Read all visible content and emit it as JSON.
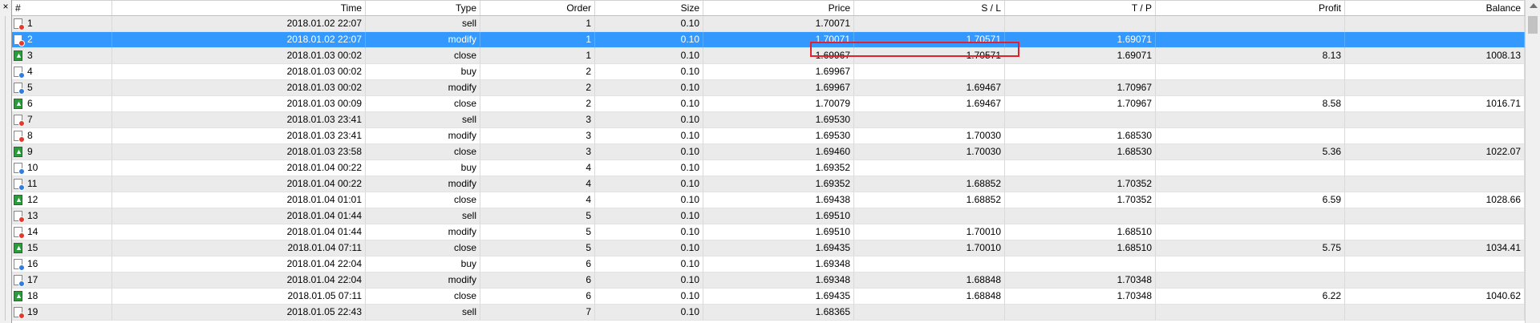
{
  "panel": {
    "close_label": "×"
  },
  "columns": [
    "#",
    "Time",
    "Type",
    "Order",
    "Size",
    "Price",
    "S / L",
    "T / P",
    "Profit",
    "Balance"
  ],
  "rows": [
    {
      "num": "1",
      "time": "2018.01.02 22:07",
      "type": "sell",
      "order": "1",
      "size": "0.10",
      "price": "1.70071",
      "sl": "",
      "tp": "",
      "profit": "",
      "balance": "",
      "icon": "sell"
    },
    {
      "num": "2",
      "time": "2018.01.02 22:07",
      "type": "modify",
      "order": "1",
      "size": "0.10",
      "price": "1.70071",
      "sl": "1.70571",
      "tp": "1.69071",
      "profit": "",
      "balance": "",
      "icon": "modify",
      "selected": true
    },
    {
      "num": "3",
      "time": "2018.01.03 00:02",
      "type": "close",
      "order": "1",
      "size": "0.10",
      "price": "1.69967",
      "sl": "1.70571",
      "tp": "1.69071",
      "profit": "8.13",
      "balance": "1008.13",
      "icon": "close"
    },
    {
      "num": "4",
      "time": "2018.01.03 00:02",
      "type": "buy",
      "order": "2",
      "size": "0.10",
      "price": "1.69967",
      "sl": "",
      "tp": "",
      "profit": "",
      "balance": "",
      "icon": "buy"
    },
    {
      "num": "5",
      "time": "2018.01.03 00:02",
      "type": "modify",
      "order": "2",
      "size": "0.10",
      "price": "1.69967",
      "sl": "1.69467",
      "tp": "1.70967",
      "profit": "",
      "balance": "",
      "icon": "buy"
    },
    {
      "num": "6",
      "time": "2018.01.03 00:09",
      "type": "close",
      "order": "2",
      "size": "0.10",
      "price": "1.70079",
      "sl": "1.69467",
      "tp": "1.70967",
      "profit": "8.58",
      "balance": "1016.71",
      "icon": "close"
    },
    {
      "num": "7",
      "time": "2018.01.03 23:41",
      "type": "sell",
      "order": "3",
      "size": "0.10",
      "price": "1.69530",
      "sl": "",
      "tp": "",
      "profit": "",
      "balance": "",
      "icon": "sell"
    },
    {
      "num": "8",
      "time": "2018.01.03 23:41",
      "type": "modify",
      "order": "3",
      "size": "0.10",
      "price": "1.69530",
      "sl": "1.70030",
      "tp": "1.68530",
      "profit": "",
      "balance": "",
      "icon": "modify"
    },
    {
      "num": "9",
      "time": "2018.01.03 23:58",
      "type": "close",
      "order": "3",
      "size": "0.10",
      "price": "1.69460",
      "sl": "1.70030",
      "tp": "1.68530",
      "profit": "5.36",
      "balance": "1022.07",
      "icon": "close"
    },
    {
      "num": "10",
      "time": "2018.01.04 00:22",
      "type": "buy",
      "order": "4",
      "size": "0.10",
      "price": "1.69352",
      "sl": "",
      "tp": "",
      "profit": "",
      "balance": "",
      "icon": "buy"
    },
    {
      "num": "11",
      "time": "2018.01.04 00:22",
      "type": "modify",
      "order": "4",
      "size": "0.10",
      "price": "1.69352",
      "sl": "1.68852",
      "tp": "1.70352",
      "profit": "",
      "balance": "",
      "icon": "buy"
    },
    {
      "num": "12",
      "time": "2018.01.04 01:01",
      "type": "close",
      "order": "4",
      "size": "0.10",
      "price": "1.69438",
      "sl": "1.68852",
      "tp": "1.70352",
      "profit": "6.59",
      "balance": "1028.66",
      "icon": "close"
    },
    {
      "num": "13",
      "time": "2018.01.04 01:44",
      "type": "sell",
      "order": "5",
      "size": "0.10",
      "price": "1.69510",
      "sl": "",
      "tp": "",
      "profit": "",
      "balance": "",
      "icon": "sell"
    },
    {
      "num": "14",
      "time": "2018.01.04 01:44",
      "type": "modify",
      "order": "5",
      "size": "0.10",
      "price": "1.69510",
      "sl": "1.70010",
      "tp": "1.68510",
      "profit": "",
      "balance": "",
      "icon": "modify"
    },
    {
      "num": "15",
      "time": "2018.01.04 07:11",
      "type": "close",
      "order": "5",
      "size": "0.10",
      "price": "1.69435",
      "sl": "1.70010",
      "tp": "1.68510",
      "profit": "5.75",
      "balance": "1034.41",
      "icon": "close"
    },
    {
      "num": "16",
      "time": "2018.01.04 22:04",
      "type": "buy",
      "order": "6",
      "size": "0.10",
      "price": "1.69348",
      "sl": "",
      "tp": "",
      "profit": "",
      "balance": "",
      "icon": "buy"
    },
    {
      "num": "17",
      "time": "2018.01.04 22:04",
      "type": "modify",
      "order": "6",
      "size": "0.10",
      "price": "1.69348",
      "sl": "1.68848",
      "tp": "1.70348",
      "profit": "",
      "balance": "",
      "icon": "buy"
    },
    {
      "num": "18",
      "time": "2018.01.05 07:11",
      "type": "close",
      "order": "6",
      "size": "0.10",
      "price": "1.69435",
      "sl": "1.68848",
      "tp": "1.70348",
      "profit": "6.22",
      "balance": "1040.62",
      "icon": "close"
    },
    {
      "num": "19",
      "time": "2018.01.05 22:43",
      "type": "sell",
      "order": "7",
      "size": "0.10",
      "price": "1.68365",
      "sl": "",
      "tp": "",
      "profit": "",
      "balance": "",
      "icon": "sell"
    }
  ],
  "colors": {
    "selection": "#3399ff",
    "highlight_border": "#e3202b",
    "row_alt": "#ebebeb"
  }
}
